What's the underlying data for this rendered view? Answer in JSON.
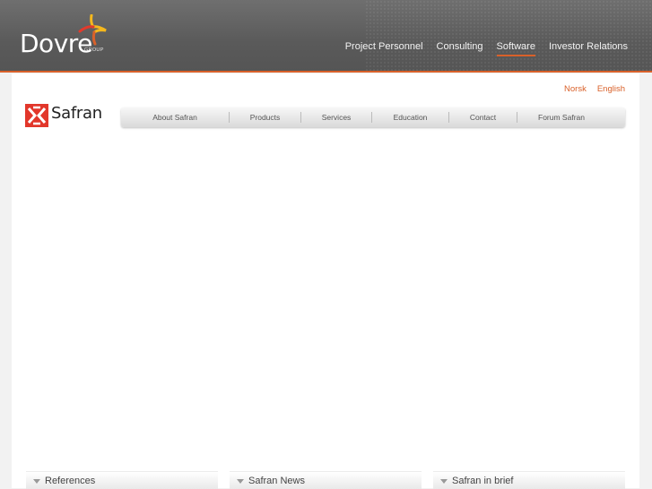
{
  "brand": {
    "name": "Dovre",
    "sub": "GROUP",
    "accent": "#d9612a"
  },
  "top_nav": [
    {
      "label": "Project Personnel",
      "active": false
    },
    {
      "label": "Consulting",
      "active": false
    },
    {
      "label": "Software",
      "active": true
    },
    {
      "label": "Investor Relations",
      "active": false
    }
  ],
  "languages": [
    "Norsk",
    "English"
  ],
  "product": {
    "name": "Safran"
  },
  "sub_nav": [
    "About Safran",
    "Products",
    "Services",
    "Education",
    "Contact",
    "Forum Safran"
  ],
  "boxes": [
    "References",
    "Safran News",
    "Safran in brief"
  ]
}
